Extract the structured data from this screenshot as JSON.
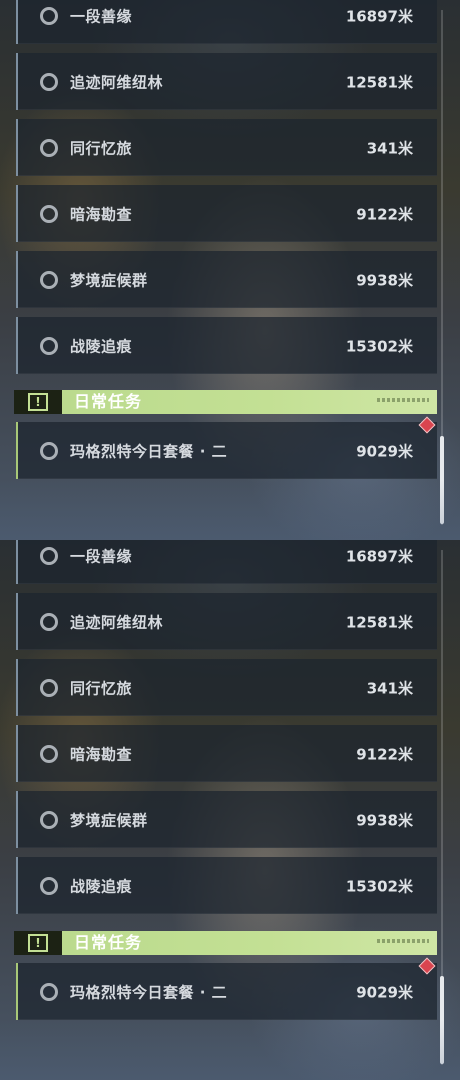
{
  "panels": [
    {
      "main_tasks": [
        {
          "name": "一段善缘",
          "distance": "16897米"
        },
        {
          "name": "追迹阿维纽林",
          "distance": "12581米"
        },
        {
          "name": "同行忆旅",
          "distance": "341米"
        },
        {
          "name": "暗海勘查",
          "distance": "9122米"
        },
        {
          "name": "梦境症候群",
          "distance": "9938米"
        },
        {
          "name": "战陵追痕",
          "distance": "15302米"
        }
      ],
      "daily_section": {
        "title": "日常任务",
        "icon": "exclamation-icon",
        "tasks": [
          {
            "name": "玛格烈特今日套餐 · 二",
            "distance": "9029米",
            "marker": "red-diamond-icon"
          }
        ]
      }
    },
    {
      "main_tasks": [
        {
          "name": "一段善缘",
          "distance": "16897米"
        },
        {
          "name": "追迹阿维纽林",
          "distance": "12581米"
        },
        {
          "name": "同行忆旅",
          "distance": "341米"
        },
        {
          "name": "暗海勘查",
          "distance": "9122米"
        },
        {
          "name": "梦境症候群",
          "distance": "9938米"
        },
        {
          "name": "战陵追痕",
          "distance": "15302米"
        }
      ],
      "daily_section": {
        "title": "日常任务",
        "icon": "exclamation-icon",
        "tasks": [
          {
            "name": "玛格烈特今日套餐 · 二",
            "distance": "9029米",
            "marker": "red-diamond-icon"
          }
        ]
      }
    }
  ],
  "colors": {
    "section_accent": "#c3e094",
    "marker": "#d9454f",
    "card_border": "#7d8fa0"
  }
}
